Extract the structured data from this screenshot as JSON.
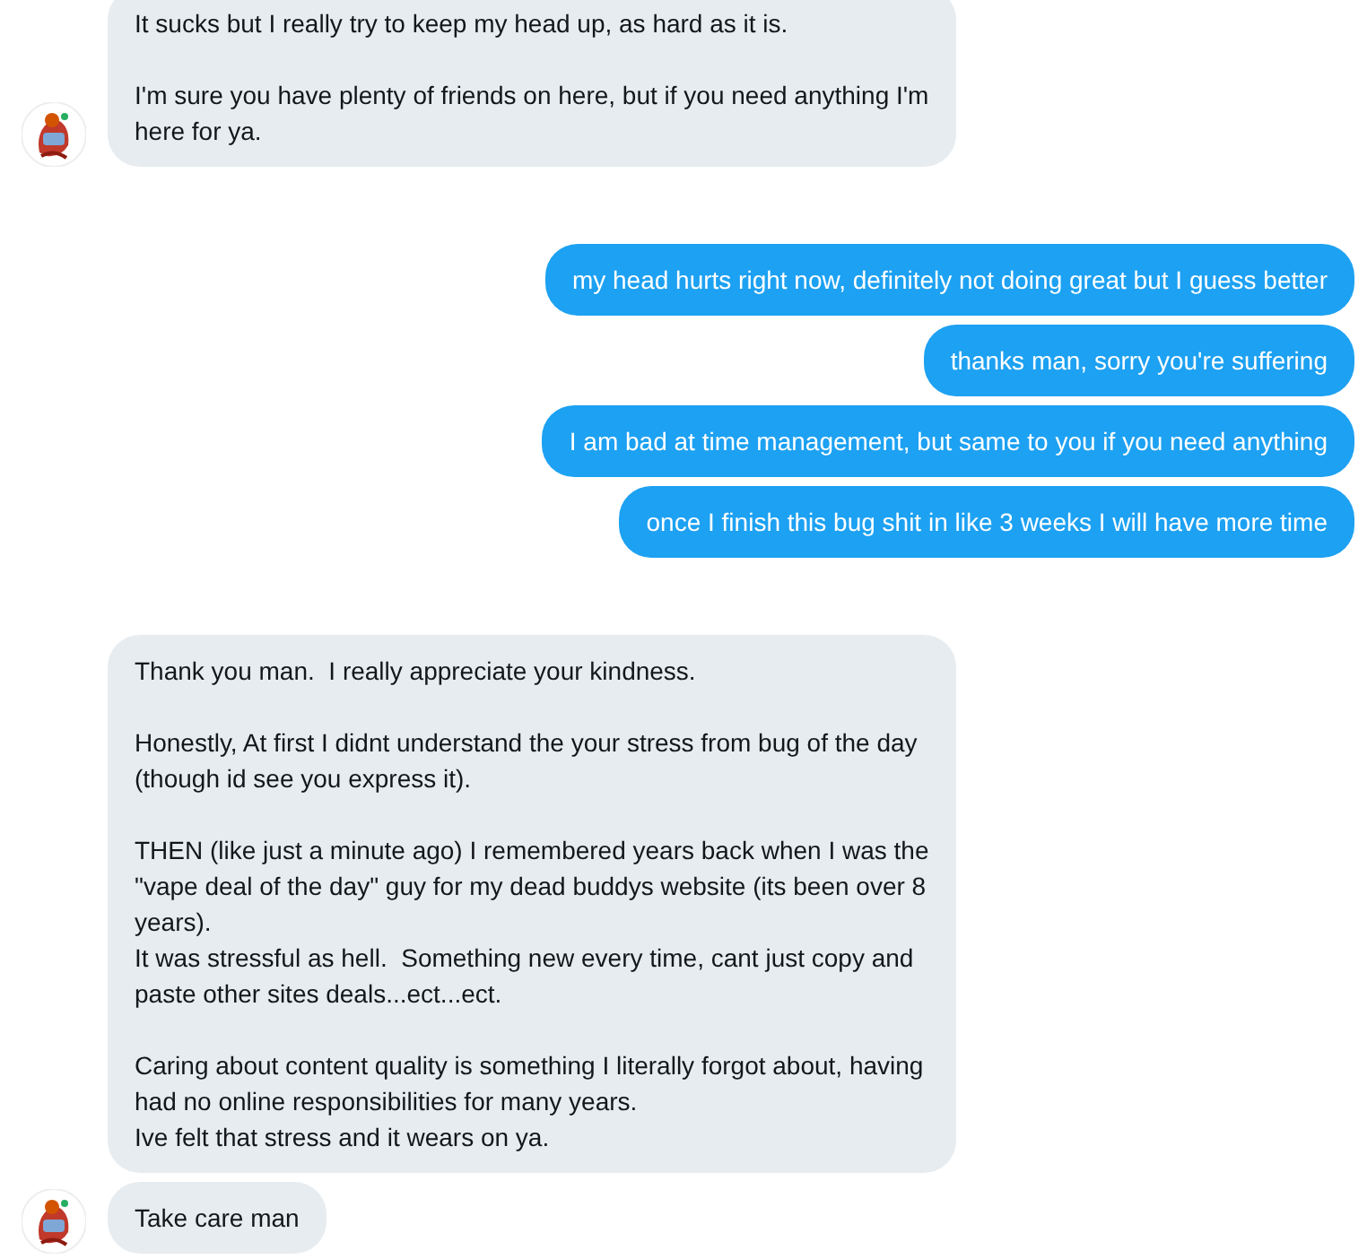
{
  "groups": [
    {
      "kind": "incoming",
      "bubbles": [
        {
          "paragraphs": [
            [
              "It sucks but I really try to keep my head up, as hard as it is."
            ],
            [
              "I'm sure you have plenty of friends on here, but if you need anything I'm",
              "here for ya."
            ]
          ]
        }
      ]
    },
    {
      "kind": "outgoing",
      "bubbles": [
        {
          "paragraphs": [
            [
              "my head hurts right now, definitely not doing great but I guess better"
            ]
          ]
        },
        {
          "paragraphs": [
            [
              "thanks man, sorry you're suffering"
            ]
          ]
        },
        {
          "paragraphs": [
            [
              "I am bad at time management, but same to you if you need anything"
            ]
          ]
        },
        {
          "paragraphs": [
            [
              "once I finish this bug shit in like 3 weeks I will have more time"
            ]
          ]
        }
      ]
    },
    {
      "kind": "incoming",
      "bubbles": [
        {
          "paragraphs": [
            [
              "Thank you man.  I really appreciate your kindness."
            ],
            [
              "Honestly, At first I didnt understand the your stress from bug of the day",
              "(though id see you express it)."
            ],
            [
              "THEN (like just a minute ago) I remembered years back when I was the",
              "\"vape deal of the day\" guy for my dead buddys website (its been over 8",
              "years).",
              "It was stressful as hell.  Something new every time, cant just copy and",
              "paste other sites deals...ect...ect."
            ],
            [
              "Caring about content quality is something I literally forgot about, having",
              "had no online responsibilities for many years.",
              "Ive felt that stress and it wears on ya."
            ]
          ]
        },
        {
          "paragraphs": [
            [
              "Take care man"
            ]
          ]
        }
      ]
    }
  ]
}
